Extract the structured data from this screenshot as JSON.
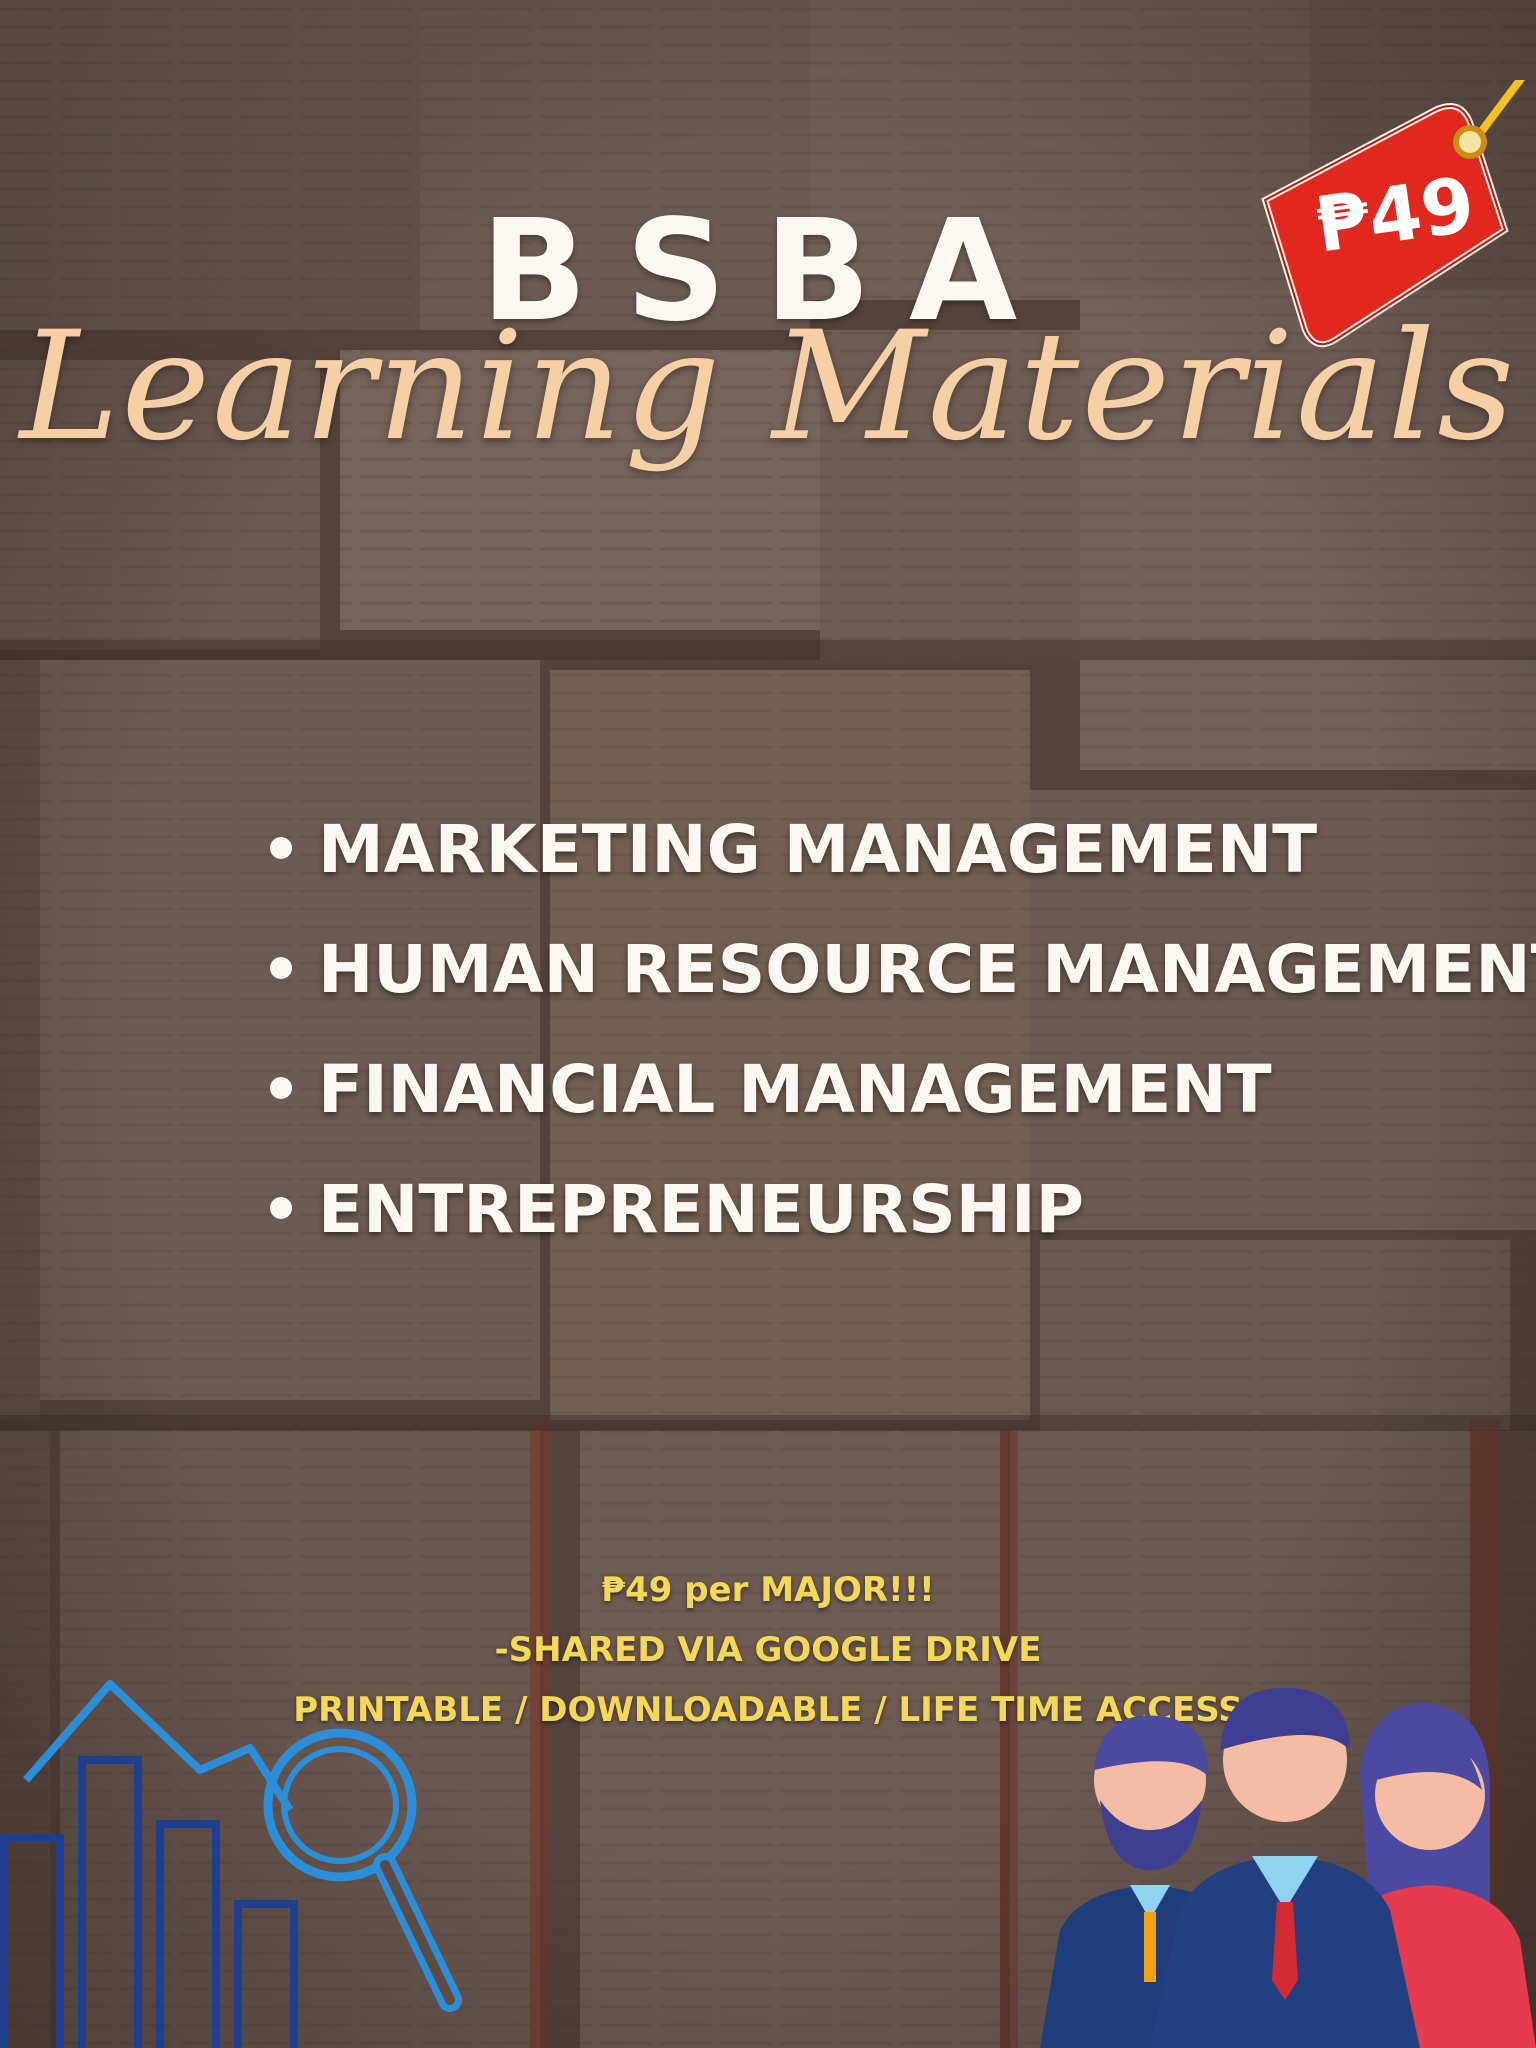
{
  "header": {
    "title": "BSBA",
    "subtitle": "Learning Materials"
  },
  "price_tag": {
    "label": "₱49",
    "color": "#e0281e",
    "string_color": "#f2c31a"
  },
  "majors": [
    "MARKETING MANAGEMENT",
    "HUMAN RESOURCE MANAGEMENT",
    "FINANCIAL MANAGEMENT",
    "ENTREPRENEURSHIP"
  ],
  "info": {
    "line1": "₱49 per MAJOR!!!",
    "line2": "-SHARED VIA GOOGLE DRIVE",
    "line3": "PRINTABLE / DOWNLOADABLE / LIFE TIME ACCESS"
  },
  "colors": {
    "title": "#fbf7f2",
    "script": "#f6cfa5",
    "info_text": "#f5d857",
    "chart_icon": "#2a8fd8",
    "chart_bars": "#1d3f8f"
  },
  "icons": {
    "left": "business-growth-chart-magnifier-icon",
    "right": "business-people-team-icon"
  }
}
